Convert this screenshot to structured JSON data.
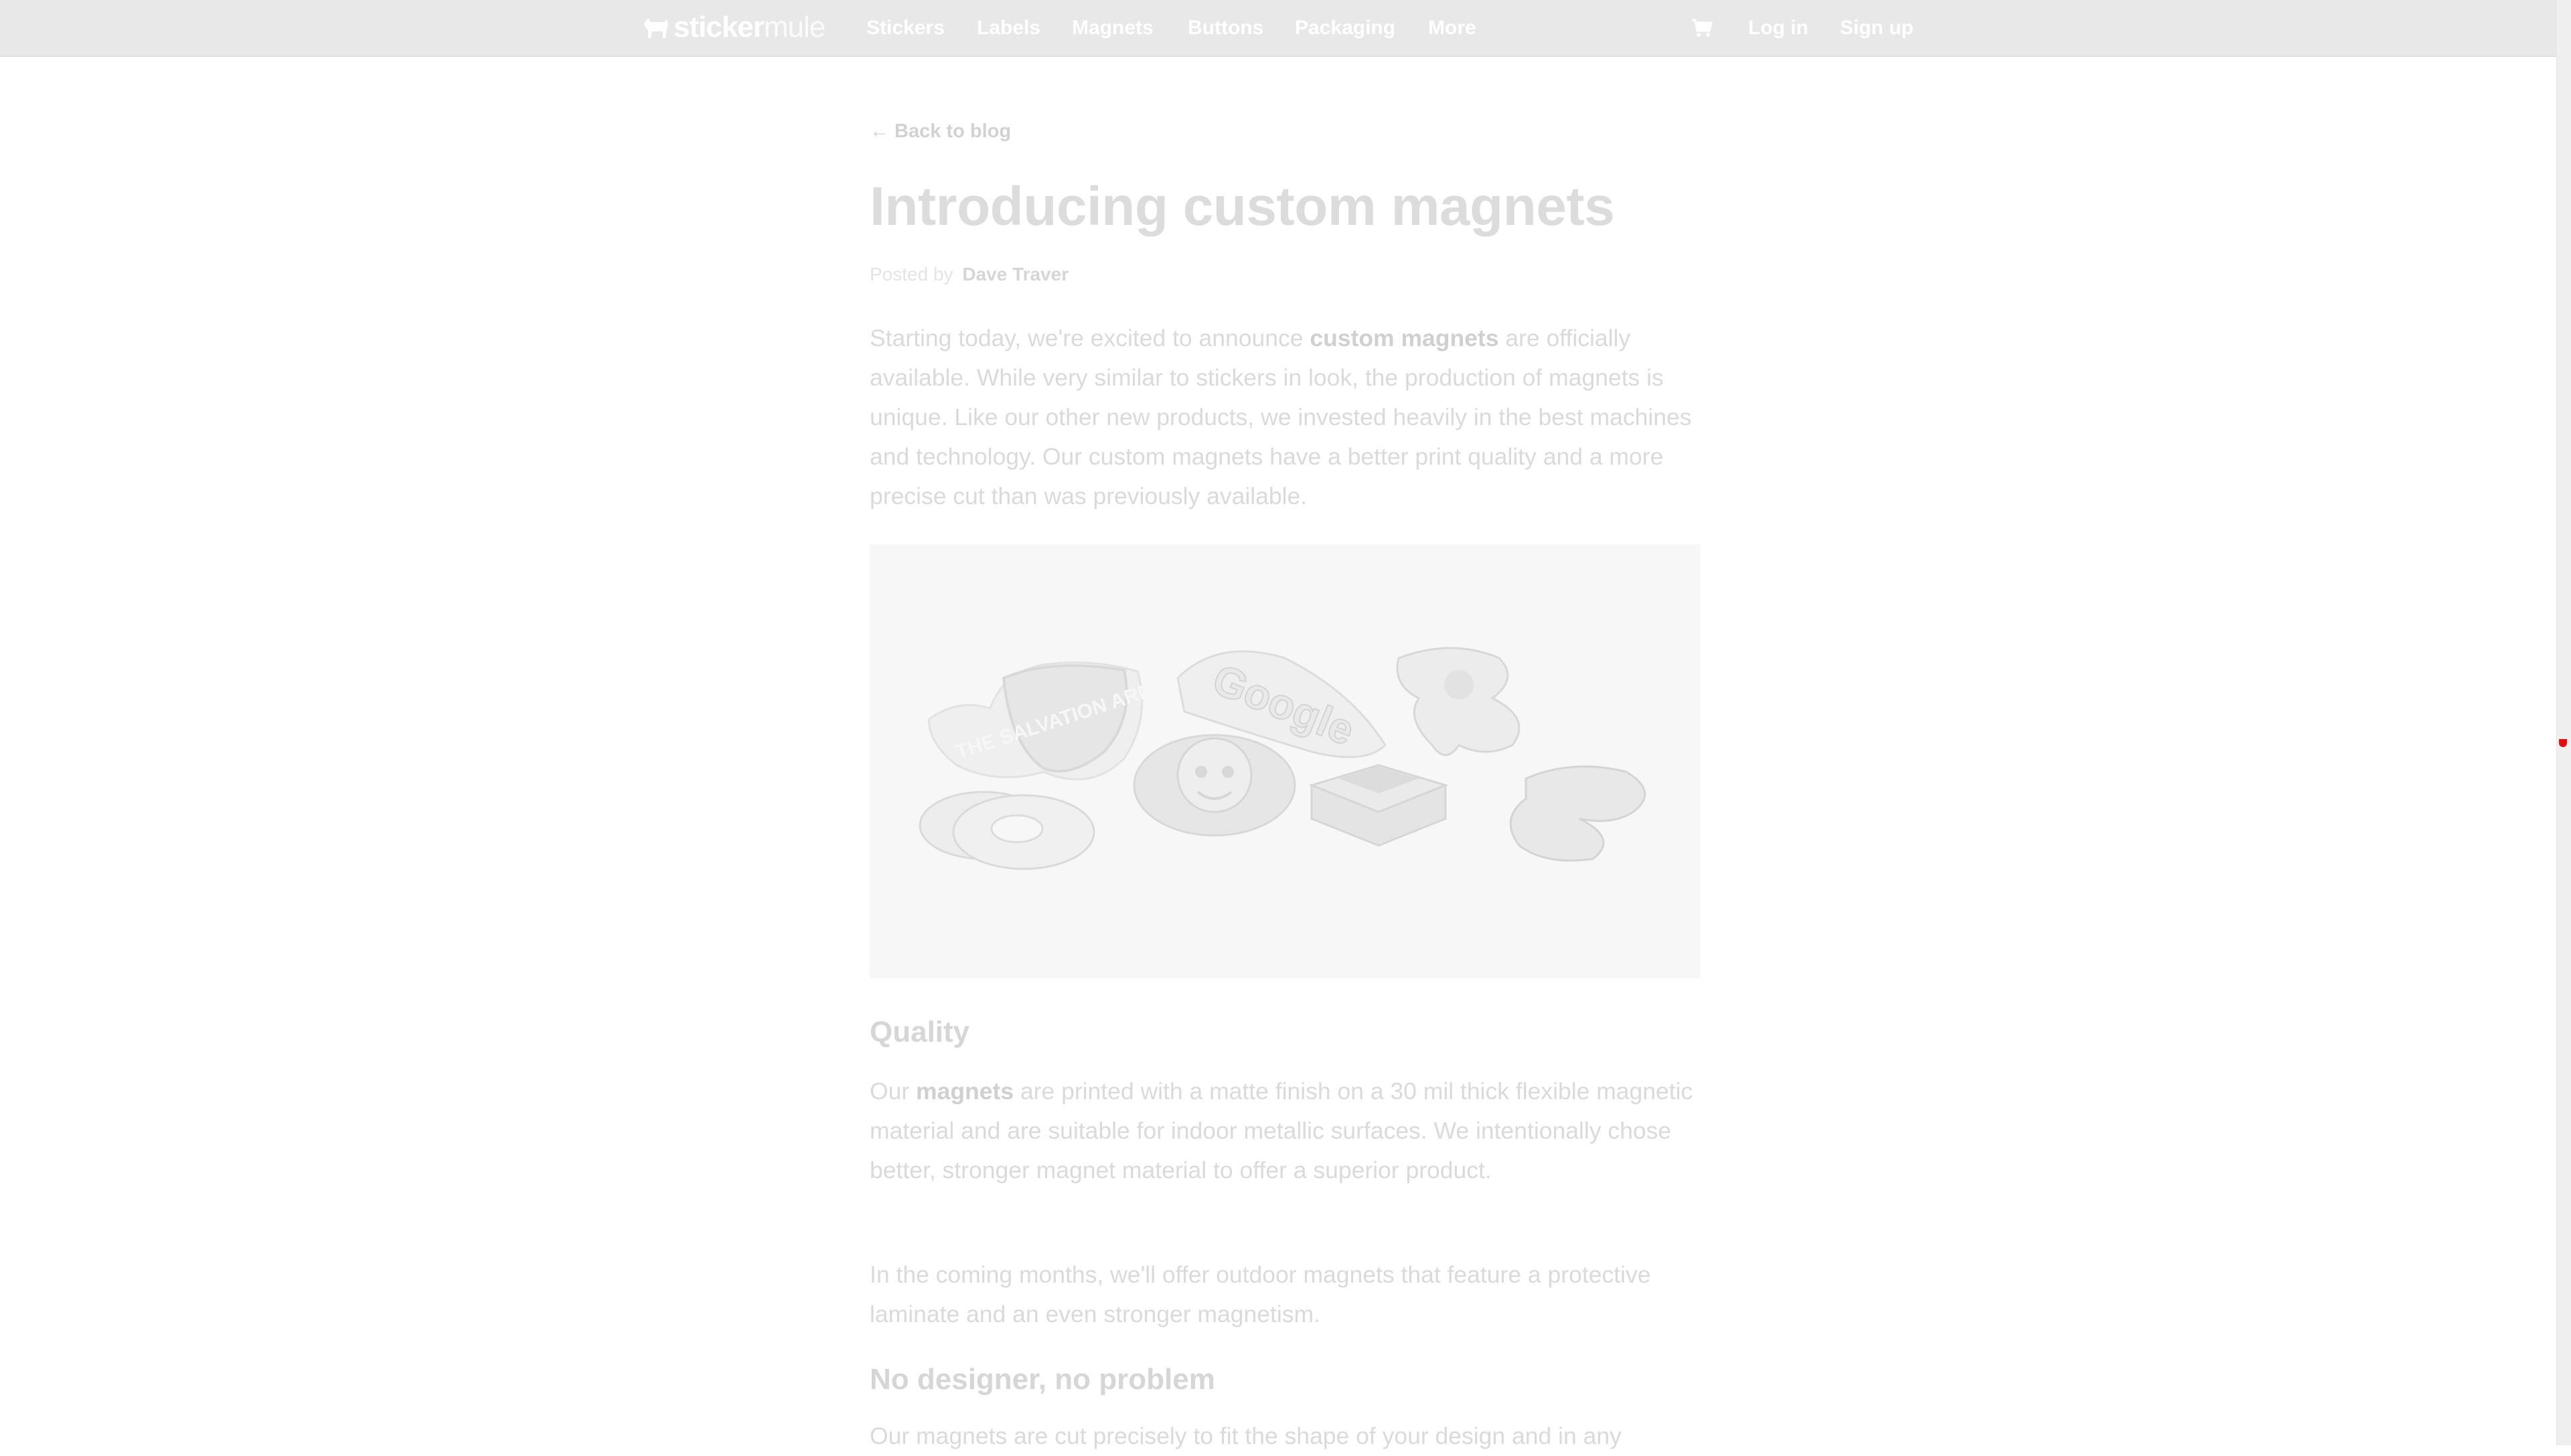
{
  "brand": {
    "logo_text_a": "sticker",
    "logo_text_b": "mule",
    "logo_icon": "mule-icon"
  },
  "nav": {
    "items": [
      {
        "label": "Stickers"
      },
      {
        "label": "Labels"
      },
      {
        "label": "Magnets"
      },
      {
        "label": "Buttons"
      },
      {
        "label": "Packaging"
      },
      {
        "label": "More"
      }
    ],
    "cart_icon": "cart-icon",
    "login": "Log in",
    "signup": "Sign up"
  },
  "article": {
    "back_link": "← Back to blog",
    "title": "Introducing custom magnets",
    "posted_by": "Posted by",
    "author": "Dave Traver",
    "intro": {
      "part1": "Starting today, we're excited to announce ",
      "link": "custom magnets",
      "part2": " are officially available. While very similar to stickers in look, the production of magnets is unique. Like our other new products, we invested heavily in the best machines and technology. Our custom magnets have a better print quality and a more precise cut than was previously available."
    },
    "hero_image": {
      "magnet_1": "THE SALVATION ARMY",
      "magnet_2": "Google"
    },
    "quality_heading": "Quality",
    "quality_p1": {
      "part1": "Our ",
      "link": "magnets",
      "part2": " are printed with a matte finish on a 30 mil thick flexible magnetic material and are suitable for indoor metallic surfaces. We intentionally chose better, stronger magnet material to offer a superior product."
    },
    "quality_p2": "In the coming months, we'll offer outdoor magnets that feature a protective laminate and an even stronger magnetism.",
    "designer_heading": "No designer, no problem",
    "designer_p1": "Our magnets are cut precisely to fit the shape of your design and in any"
  },
  "colors": {
    "overlay_bg": "#e8e8e8",
    "text_faded": "#dadada",
    "scroll_marker": "#e01010"
  }
}
